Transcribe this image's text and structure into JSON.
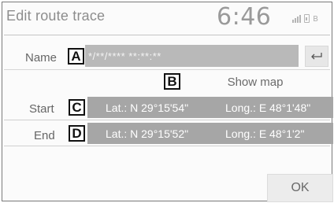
{
  "header": {
    "title": "Edit route trace",
    "clock": "6:46",
    "icons": [
      "signal-icon",
      "phone-icon",
      "bluetooth-icon"
    ]
  },
  "name": {
    "label": "Name",
    "value": "*/**/**** **:**:**"
  },
  "show_map_label": "Show map",
  "start": {
    "label": "Start",
    "lat": "Lat.: N 29°15'54\"",
    "lon": "Long.: E 48°1'48\""
  },
  "end": {
    "label": "End",
    "lat": "Lat.: N 29°15'52\"",
    "lon": "Long.: E 48°1'2\""
  },
  "ok_label": "OK",
  "callouts": [
    "A",
    "B",
    "C",
    "D"
  ],
  "colors": {
    "field_bg": "#b9b9b9",
    "row_bg": "#a6a6a6",
    "text_gray": "#666666"
  }
}
